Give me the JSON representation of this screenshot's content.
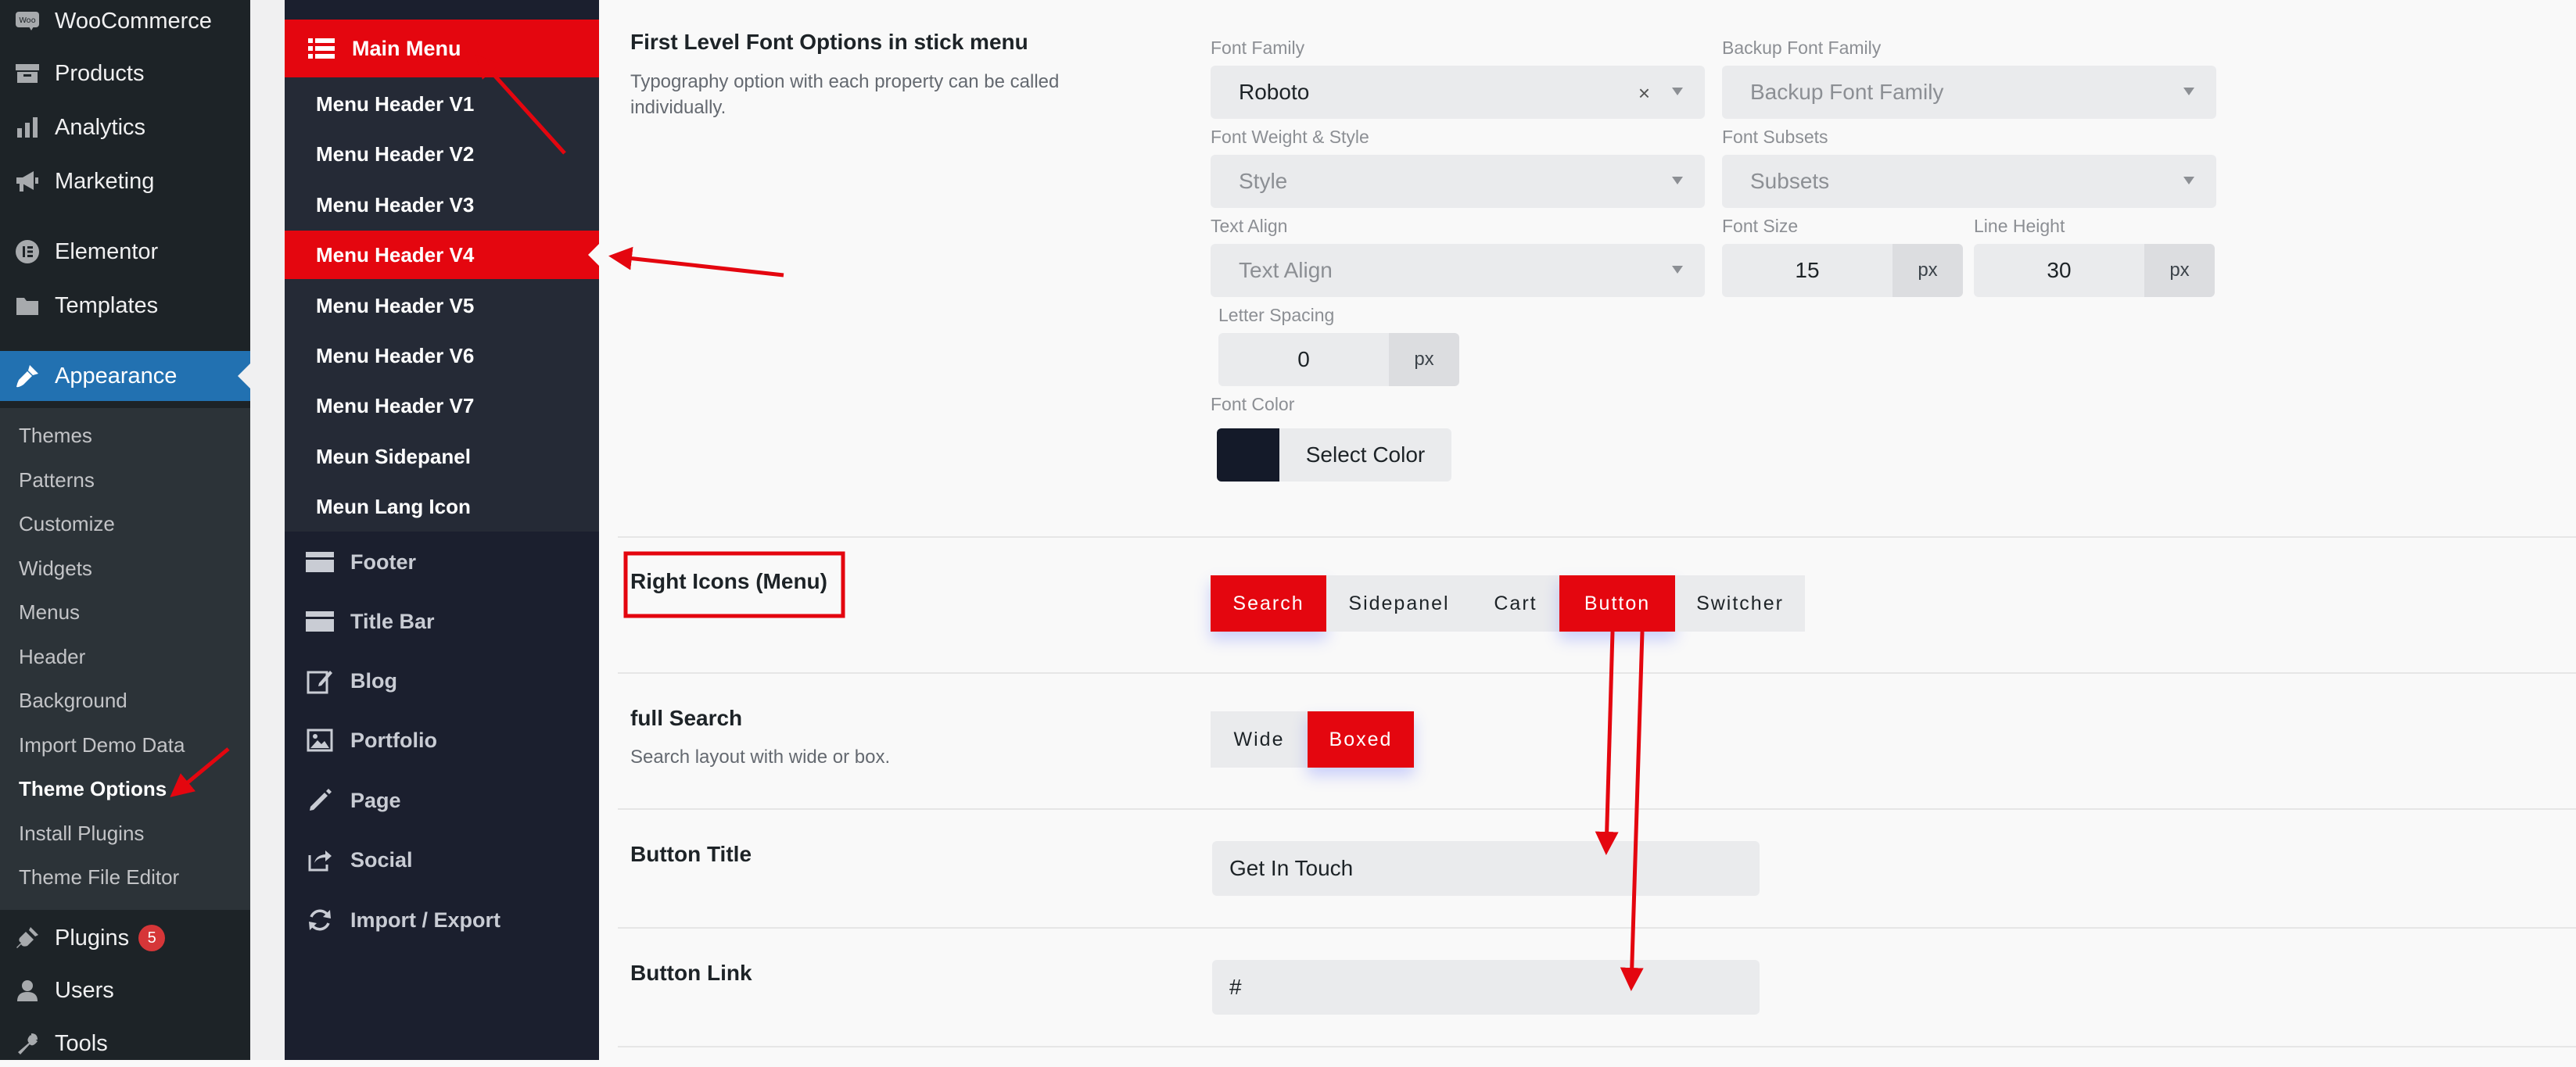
{
  "wp_menu": {
    "items": [
      {
        "label": "WooCommerce",
        "icon": "woocommerce-icon"
      },
      {
        "label": "Products",
        "icon": "archive-icon"
      },
      {
        "label": "Analytics",
        "icon": "bar-chart-icon"
      },
      {
        "label": "Marketing",
        "icon": "megaphone-icon"
      },
      {
        "label": "Elementor",
        "icon": "elementor-icon"
      },
      {
        "label": "Templates",
        "icon": "folder-icon"
      },
      {
        "label": "Appearance",
        "icon": "paintbrush-icon"
      },
      {
        "label": "Plugins",
        "icon": "plug-icon",
        "badge": "5"
      },
      {
        "label": "Users",
        "icon": "user-icon"
      },
      {
        "label": "Tools",
        "icon": "wrench-icon"
      }
    ],
    "submenu": [
      "Themes",
      "Patterns",
      "Customize",
      "Widgets",
      "Menus",
      "Header",
      "Background",
      "Import Demo Data",
      "Theme Options",
      "Install Plugins",
      "Theme File Editor"
    ]
  },
  "options_nav": {
    "main_menu": "Main Menu",
    "sub_items": [
      "Menu Header V1",
      "Menu Header V2",
      "Menu Header V3",
      "Menu Header V4",
      "Menu Header V5",
      "Menu Header V6",
      "Menu Header V7",
      "Meun Sidepanel",
      "Meun Lang Icon"
    ],
    "sections": [
      {
        "label": "Footer",
        "icon": "footer-icon"
      },
      {
        "label": "Title Bar",
        "icon": "title-bar-icon"
      },
      {
        "label": "Blog",
        "icon": "edit-icon"
      },
      {
        "label": "Portfolio",
        "icon": "image-icon"
      },
      {
        "label": "Page",
        "icon": "pencil-icon"
      },
      {
        "label": "Social",
        "icon": "share-icon"
      },
      {
        "label": "Import / Export",
        "icon": "refresh-icon"
      }
    ]
  },
  "typography": {
    "title": "First Level Font Options in stick menu",
    "desc": "Typography option with each property can be called individually.",
    "font_family_label": "Font Family",
    "font_family_value": "Roboto",
    "backup_font_label": "Backup Font Family",
    "backup_font_placeholder": "Backup Font Family",
    "weight_label": "Font Weight & Style",
    "weight_placeholder": "Style",
    "subsets_label": "Font Subsets",
    "subsets_placeholder": "Subsets",
    "align_label": "Text Align",
    "align_placeholder": "Text Align",
    "size_label": "Font Size",
    "size_value": "15",
    "line_height_label": "Line Height",
    "line_height_value": "30",
    "letter_spacing_label": "Letter Spacing",
    "letter_spacing_value": "0",
    "unit": "px",
    "color_label": "Font Color",
    "color_button": "Select Color",
    "color_value": "#141a29"
  },
  "right_icons": {
    "title": "Right Icons (Menu)",
    "options": [
      {
        "label": "Search",
        "on": true
      },
      {
        "label": "Sidepanel",
        "on": false
      },
      {
        "label": "Cart",
        "on": false
      },
      {
        "label": "Button",
        "on": true
      },
      {
        "label": "Switcher",
        "on": false
      }
    ]
  },
  "full_search": {
    "title": "full Search",
    "desc": "Search layout with wide or box.",
    "options": [
      {
        "label": "Wide",
        "on": false
      },
      {
        "label": "Boxed",
        "on": true
      }
    ]
  },
  "button_title": {
    "title": "Button Title",
    "value": "Get In Touch"
  },
  "button_link": {
    "title": "Button Link",
    "value": "#"
  },
  "colors": {
    "accent": "#e4060f",
    "wp_blue": "#2271b1"
  }
}
